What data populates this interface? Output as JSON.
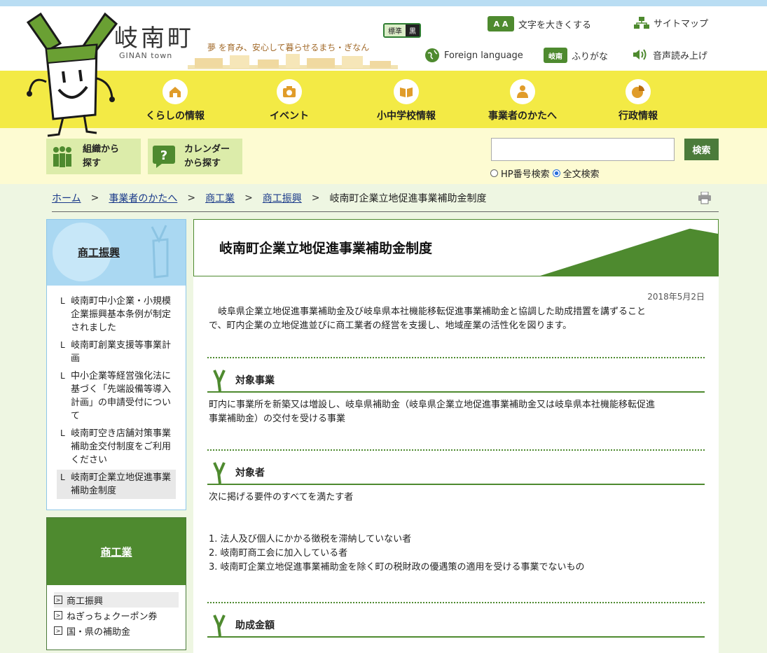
{
  "header": {
    "town_name": "岐南町",
    "town_roman": "GINAN town",
    "slogan": "夢 を育み、安心して暮らせるまち・ぎなん",
    "color_standard": "標準",
    "color_black": "黒",
    "text_size_icon": "A A",
    "text_size_label": "文字を大きくする",
    "sitemap_label": "サイトマップ",
    "foreign_label": "Foreign language",
    "furigana_icon": "岐南",
    "furigana_label": "ふりがな",
    "voice_label": "音声読み上げ"
  },
  "global_nav": [
    {
      "label": "くらしの情報",
      "icon": "house-icon"
    },
    {
      "label": "イベント",
      "icon": "camera-icon"
    },
    {
      "label": "小中学校情報",
      "icon": "book-icon"
    },
    {
      "label": "事業者のかたへ",
      "icon": "person-icon"
    },
    {
      "label": "行政情報",
      "icon": "chart-icon"
    }
  ],
  "subnav": {
    "org_line1": "組織から",
    "org_line2": "探す",
    "cal_line1": "カレンダー",
    "cal_line2": "から探す"
  },
  "search": {
    "button": "検索",
    "radio_hp": "HP番号検索",
    "radio_full": "全文検索",
    "selected": "全文検索"
  },
  "breadcrumb": {
    "items": [
      "ホーム",
      "事業者のかたへ",
      "商工業",
      "商工振興"
    ],
    "current": "岐南町企業立地促進事業補助金制度"
  },
  "sidebar1": {
    "title": "商工振興",
    "items": [
      "岐南町中小企業・小規模企業振興基本条例が制定されました",
      "岐南町創業支援等事業計画",
      "中小企業等経営強化法に基づく「先端設備等導入計画」の申請受付について",
      "岐南町空き店舗対策事業補助金交付制度をご利用ください",
      "岐南町企業立地促進事業補助金制度"
    ]
  },
  "sidebar2": {
    "title": "商工業",
    "items": [
      "商工振興",
      "ねぎっちょクーポン券",
      "国・県の補助金"
    ]
  },
  "main": {
    "title": "岐南町企業立地促進事業補助金制度",
    "date": "2018年5月2日",
    "intro_line1": "　岐阜県企業立地促進事業補助金及び岐阜県本社機能移転促進事業補助金と協調した助成措置を講ずること",
    "intro_line2": "で、町内企業の立地促進並びに商工業者の経営を支援し、地域産業の活性化を図ります。",
    "h_target_business": "対象事業",
    "target_business_line1": "町内に事業所を新築又は増設し、岐阜県補助金（岐阜県企業立地促進事業補助金又は岐阜県本社機能移転促進",
    "target_business_line2": "事業補助金）の交付を受ける事業",
    "h_target_person": "対象者",
    "target_person_text": "次に掲げる要件のすべてを満たす者",
    "requirements": [
      "1. 法人及び個人にかかる徴税を滞納していない者",
      "2. 岐南町商工会に加入している者",
      "3. 岐南町企業立地促進事業補助金を除く町の税財政の優遇策の適用を受ける事業でないもの"
    ],
    "h_amount": "助成金額"
  },
  "colors": {
    "accent_green": "#4e8a2f",
    "nav_yellow": "#f3ea45",
    "sky_blue": "#aad8f2"
  }
}
